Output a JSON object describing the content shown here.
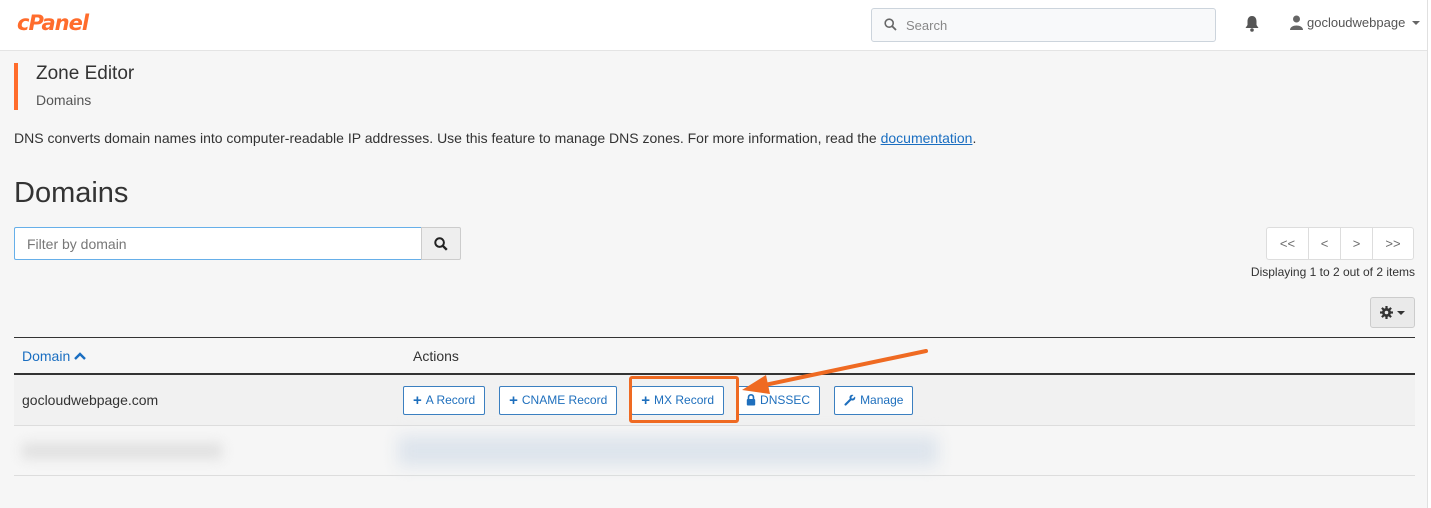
{
  "header": {
    "logo": "cPanel",
    "search_placeholder": "Search",
    "username": "gocloudwebpage"
  },
  "page": {
    "title": "Zone Editor",
    "subtitle": "Domains",
    "description_prefix": "DNS converts domain names into computer-readable IP addresses. Use this feature to manage DNS zones. For more information, read the ",
    "description_link": "documentation",
    "description_suffix": "."
  },
  "domains_section": {
    "heading": "Domains",
    "filter_placeholder": "Filter by domain",
    "pager": [
      "<<",
      "<",
      ">",
      ">>"
    ],
    "display_count": "Displaying 1 to 2 out of 2 items"
  },
  "table": {
    "columns": [
      "Domain",
      "Actions"
    ],
    "rows": [
      {
        "domain": "gocloudwebpage.com",
        "actions": [
          "A Record",
          "CNAME Record",
          "MX Record",
          "DNSSEC",
          "Manage"
        ]
      }
    ]
  },
  "annotation": {
    "highlighted_action": "MX Record",
    "color": "#ef6a22"
  },
  "colors": {
    "brand": "#ff6c2c",
    "link": "#1a6ec1"
  }
}
